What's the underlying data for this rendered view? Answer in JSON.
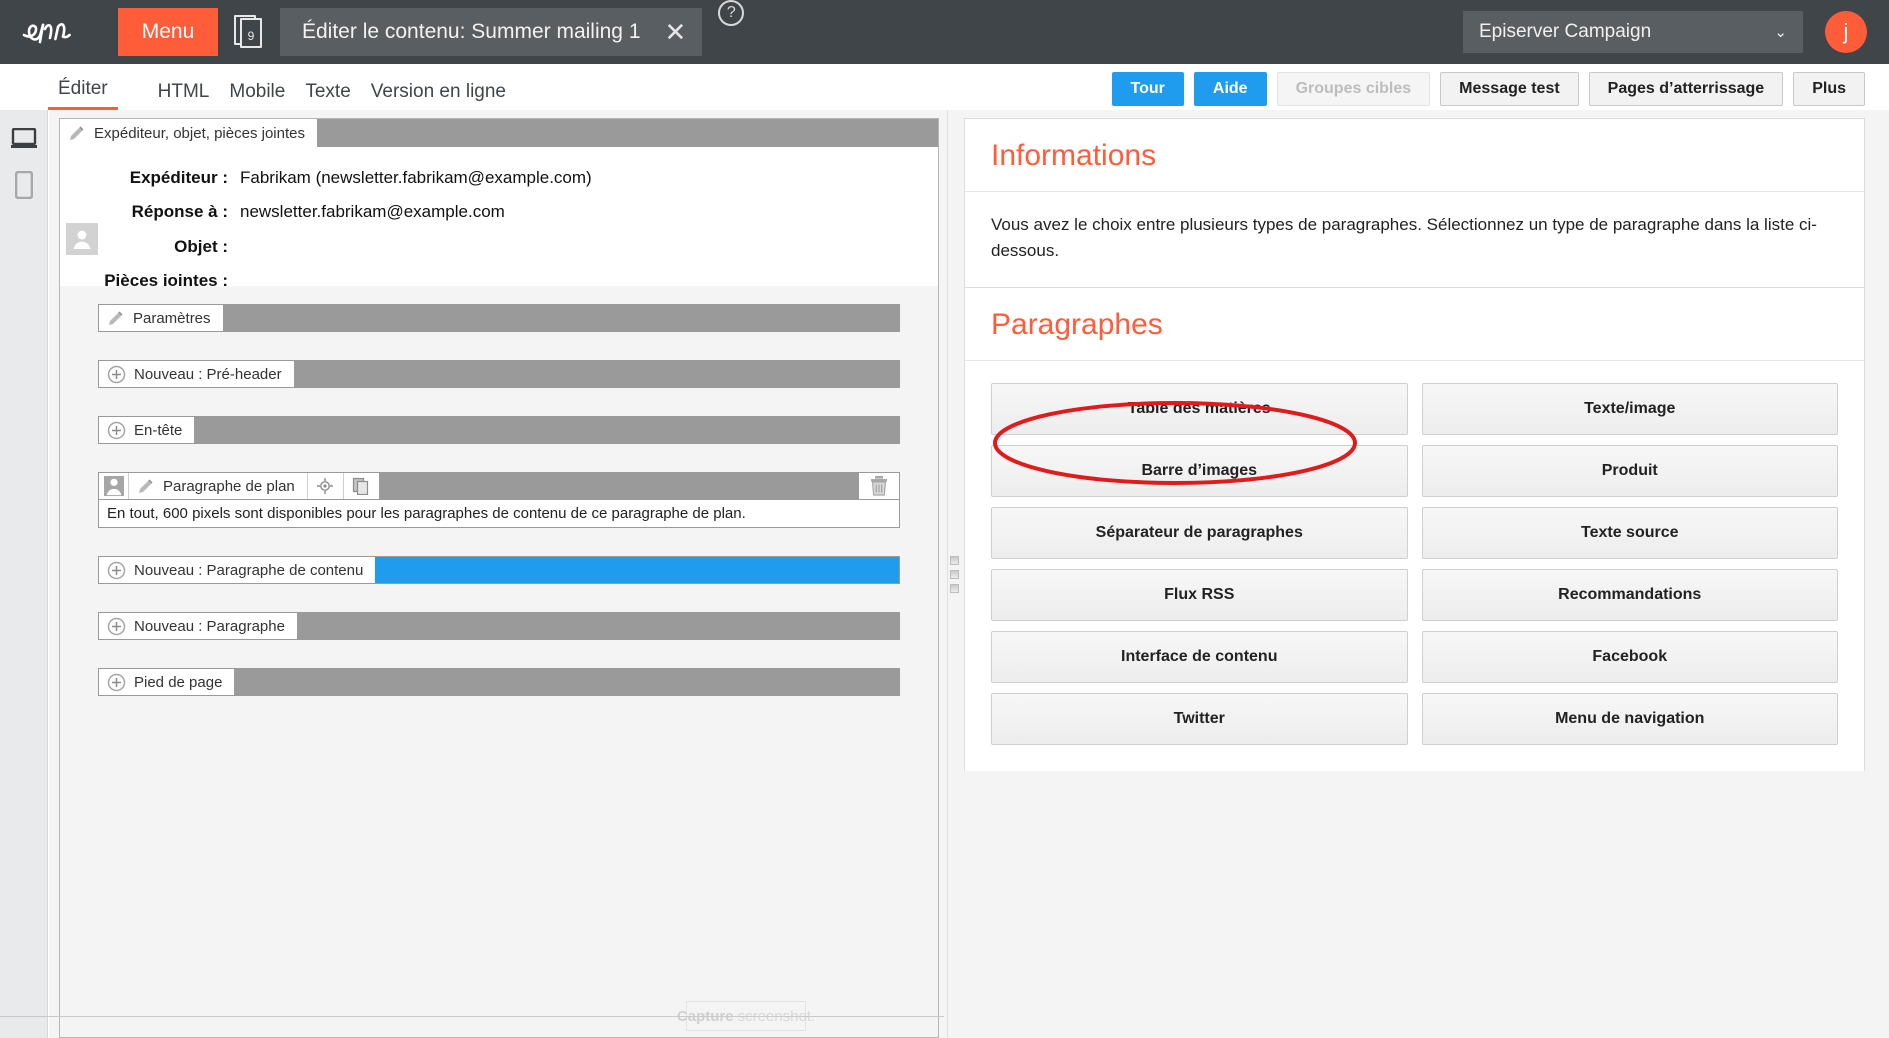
{
  "topbar": {
    "logo_alt": "Episerver logo",
    "menu_label": "Menu",
    "doc_badge": "9",
    "tab_title": "Éditer le contenu: Summer mailing 1",
    "close_label": "✕",
    "help_label": "?",
    "client": "Episerver Campaign",
    "client_chevron": "⌄",
    "avatar_initial": "j"
  },
  "subbar": {
    "tabs": [
      {
        "label": "Éditer",
        "active": true
      },
      {
        "label": "HTML",
        "active": false
      },
      {
        "label": "Mobile",
        "active": false
      },
      {
        "label": "Texte",
        "active": false
      },
      {
        "label": "Version en ligne",
        "active": false
      }
    ],
    "actions": [
      {
        "label": "Tour",
        "style": "blue"
      },
      {
        "label": "Aide",
        "style": "blue"
      },
      {
        "label": "Groupes cibles",
        "style": "disabled"
      },
      {
        "label": "Message test",
        "style": "grey"
      },
      {
        "label": "Pages d’atterrissage",
        "style": "grey"
      },
      {
        "label": "Plus",
        "style": "grey"
      }
    ]
  },
  "rail": {
    "desktop_icon": "desktop-preview-icon",
    "mobile_icon": "mobile-preview-icon"
  },
  "editor": {
    "sender_bar_label": "Expéditeur, objet, pièces jointes",
    "fields": [
      {
        "label": "Expéditeur :",
        "value": "Fabrikam (newsletter.fabrikam@example.com)"
      },
      {
        "label": "Réponse à :",
        "value": "newsletter.fabrikam@example.com"
      },
      {
        "label": "Objet :",
        "value": ""
      },
      {
        "label": "Pièces jointes :",
        "value": ""
      }
    ],
    "blocks": [
      {
        "type": "settings",
        "label": "Paramètres",
        "icon": "pencil-icon",
        "fill": "grey"
      },
      {
        "type": "new",
        "label": "Nouveau : Pré-header",
        "icon": "plus-icon",
        "fill": "grey"
      },
      {
        "type": "new",
        "label": "En-tête",
        "icon": "plus-icon",
        "fill": "grey"
      }
    ],
    "plan_block": {
      "label": "Paragraphe de plan",
      "person_icon": "person-icon",
      "pencil_icon": "pencil-icon",
      "target_icon": "target-icon",
      "copy_icon": "copy-icon",
      "trash_icon": "trash-icon",
      "info": "En tout, 600 pixels sont disponibles pour les paragraphes de contenu de ce paragraphe de plan."
    },
    "blocks_after": [
      {
        "type": "new",
        "label": "Nouveau : Paragraphe de contenu",
        "icon": "plus-icon",
        "fill": "blue"
      },
      {
        "type": "new",
        "label": "Nouveau : Paragraphe",
        "icon": "plus-icon",
        "fill": "grey"
      },
      {
        "type": "new",
        "label": "Pied de page",
        "icon": "plus-icon",
        "fill": "grey"
      }
    ],
    "capture_bold": "Capture",
    "capture_rest": "screenshot."
  },
  "sidepanel": {
    "info_title": "Informations",
    "info_text": "Vous avez le choix entre plusieurs types de paragraphes. Sélectionnez un type de paragraphe dans la liste ci-dessous.",
    "paragraphs_title": "Paragraphes",
    "paragraph_types": [
      "Table des matières",
      "Texte/image",
      "Barre d’images",
      "Produit",
      "Séparateur de paragraphes",
      "Texte source",
      "Flux RSS",
      "Recommandations",
      "Interface de contenu",
      "Facebook",
      "Twitter",
      "Menu de navigation"
    ],
    "highlighted_item": "Table des matières"
  },
  "colors": {
    "brand_orange": "#ff5c39",
    "header_dark": "#3f4549",
    "accent_blue": "#1f9ced",
    "annotation_red": "#e01b1b",
    "bar_grey": "#9a9a9a"
  }
}
